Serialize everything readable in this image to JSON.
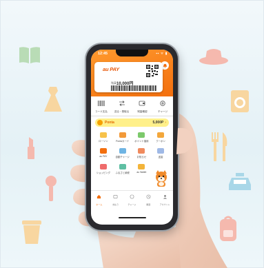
{
  "colors": {
    "accent": "#f36f0e",
    "background": "#e8f3f7",
    "bg_icon_green": "#b9dcb6",
    "bg_icon_pink": "#f5b9ae",
    "bg_icon_yellow": "#f8d6a0",
    "bg_icon_blue": "#a9d7e8",
    "ponta_yellow": "#fff08a"
  },
  "background_icons": [
    "book-icon",
    "dress-icon",
    "lipstick-icon",
    "microphone-icon",
    "cup-icon",
    "hat-icon",
    "washing-machine-icon",
    "fork-knife-icon",
    "car-icon",
    "backpack-icon"
  ],
  "phone": {
    "status": {
      "time": "12:45",
      "icons": "▪▪ ᯤ ▮"
    },
    "card": {
      "brand": "au PAY",
      "balance_label": "残高",
      "balance": "10,000",
      "balance_suffix": "円"
    },
    "actions": [
      {
        "label": "コード支払",
        "icon": "barcode-icon"
      },
      {
        "label": "送る・受取る",
        "icon": "send-icon"
      },
      {
        "label": "残高確認",
        "icon": "wallet-icon"
      },
      {
        "label": "チャージ",
        "icon": "charge-icon"
      }
    ],
    "ponta": {
      "name": "Ponta",
      "points": "5,000",
      "unit": "P"
    },
    "grid": [
      [
        {
          "label": "ローソン",
          "color": "#f7c24a"
        },
        {
          "label": "Pontaカード",
          "color": "#f29a3a"
        },
        {
          "label": "ポイント運用",
          "color": "#7cc96b"
        },
        {
          "label": "クーポン",
          "color": "#f3a73c"
        }
      ],
      [
        {
          "label": "au PAY",
          "color": "#f36f0e"
        },
        {
          "label": "自動チャージ",
          "color": "#6fb4e3"
        },
        {
          "label": "お知らせ",
          "color": "#f08a5d"
        },
        {
          "label": "送金",
          "color": "#9fb9e6"
        }
      ],
      [
        {
          "label": "ショッピング",
          "color": "#ef6b6b"
        },
        {
          "label": "ふるさと納税",
          "color": "#5fbfa3"
        },
        {
          "label": "au Wallet",
          "color": "#f3b43a"
        },
        {
          "label": "",
          "color": "#ffffff"
        }
      ]
    ],
    "tabs": [
      {
        "label": "ホーム",
        "icon": "home-icon",
        "active": true
      },
      {
        "label": "支払う",
        "icon": "pay-icon",
        "active": false
      },
      {
        "label": "チャージ",
        "icon": "charge-tab-icon",
        "active": false
      },
      {
        "label": "履歴",
        "icon": "history-icon",
        "active": false
      },
      {
        "label": "アカウント",
        "icon": "account-icon",
        "active": false
      }
    ]
  }
}
